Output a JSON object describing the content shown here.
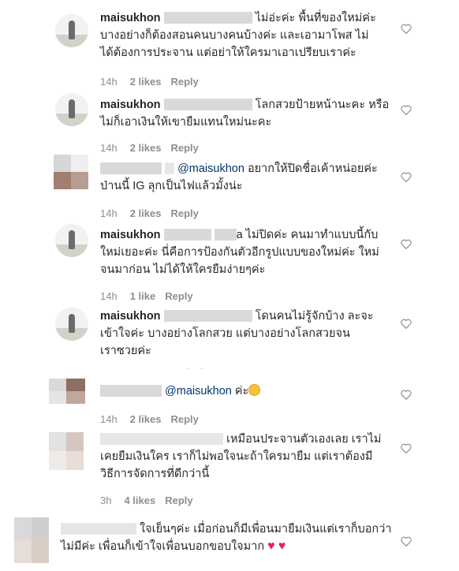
{
  "comments": [
    {
      "username": "maisukhon",
      "lines": [
        "ไม่อ่ะค่ะ พื้นที่ของใหม่ค่ะ",
        "บางอย่างก็ต้องสอนคนบางคนบ้างค่ะ และเอามาโพส ไม่",
        "ได้ต้องการประจาน แต่อย่าให้ใครมาเอาเปรียบเราค่ะ"
      ],
      "time": "14h",
      "likes": "2 likes",
      "reply": "Reply"
    },
    {
      "username": "maisukhon",
      "lines": [
        "โลกสวยป้ายหน้านะคะ หรือ",
        "ไม่ก็เอาเงินให้เขายืมแทนใหม่นะคะ"
      ],
      "time": "14h",
      "likes": "2 likes",
      "reply": "Reply"
    },
    {
      "username": "",
      "mention": "@maisukhon",
      "lines": [
        "อยากให้ปิดชื่อเค้าหน่อยค่ะ",
        "ป่านนี้ IG ลุกเป็นไฟแล้วมั้งน่ะ"
      ],
      "time": "14h",
      "likes": "2 likes",
      "reply": "Reply"
    },
    {
      "username": "maisukhon",
      "lines": [
        "a ไม่ปิดค่ะ คนมาทำแบบนี้กับ",
        "ใหม่เยอะค่ะ นี่คือการป้องกันตัวอีกรูปแบบของใหม่ค่ะ ใหม่",
        "จนมาก่อน ไม่ได้ให้ใครยืมง่ายๆค่ะ"
      ],
      "time": "14h",
      "likes": "1 like",
      "reply": "Reply"
    },
    {
      "username": "maisukhon",
      "lines": [
        "โดนคนไม่รู้จักบ้าง ละจะ",
        "เข้าใจค่ะ บางอย่างโลกสวย แต่บางอย่างโลกสวยจน",
        "เราซวยค่ะ"
      ]
    },
    {
      "username": "",
      "mention": "@maisukhon",
      "lines": [
        "ค่ะ"
      ],
      "time": "14h",
      "likes": "2 likes",
      "reply": "Reply"
    },
    {
      "username": "",
      "lines": [
        "เหมือนประจานตัวเองเลย เราไม่",
        "เคยยืมเงินใคร เราก็ไม่พอใจนะถ้าใครมายืม แต่เราต้องมี",
        "วิธีการจัดการที่ดีกว่านี้"
      ],
      "time": "3h",
      "likes": "4 likes",
      "reply": "Reply"
    },
    {
      "username": "",
      "lines": [
        "ใจเย็นๆค่ะ เมื่อก่อนก็มีเพื่อนมายืมเงินแต่เราก็บอกว่า",
        "ไม่มีค่ะ เพื่อนก็เข้าใจเพื่อนบอกขอบใจมาก"
      ]
    }
  ]
}
